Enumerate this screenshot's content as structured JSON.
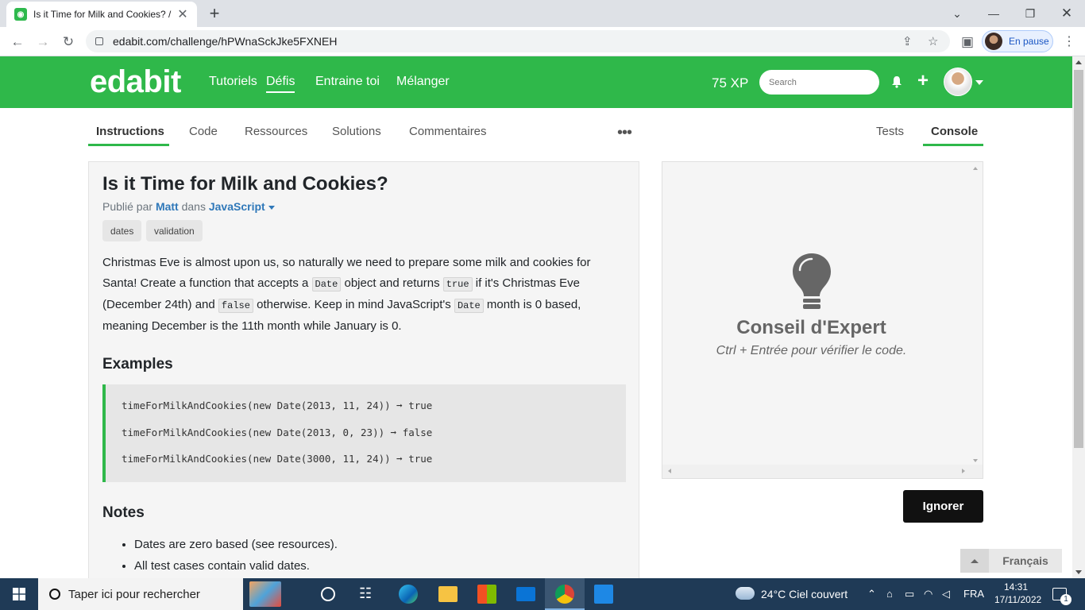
{
  "browser": {
    "tab_title": "Is it Time for Milk and Cookies? /",
    "url": "edabit.com/challenge/hPWnaSckJke5FXNEH",
    "profile_label": "En pause"
  },
  "site": {
    "logo": "edabit",
    "nav": [
      "Tutoriels",
      "Défis",
      "Entraine toi",
      "Mélanger"
    ],
    "active_nav": "Défis",
    "xp": "75 XP",
    "search_placeholder": "Search"
  },
  "tabs_left": [
    "Instructions",
    "Code",
    "Ressources",
    "Solutions",
    "Commentaires"
  ],
  "tabs_more": "•••",
  "tabs_right": [
    "Tests",
    "Console"
  ],
  "challenge": {
    "title": "Is it Time for Milk and Cookies?",
    "published_by": "Publié par",
    "author": "Matt",
    "in": "dans",
    "language": "JavaScript",
    "tags": [
      "dates",
      "validation"
    ],
    "desc_1": "Christmas Eve is almost upon us, so naturally we need to prepare some milk and cookies for Santa! Create a function that accepts a",
    "code_date": "Date",
    "desc_2": "object and returns",
    "code_true": "true",
    "desc_3": "if it's Christmas Eve (December 24th) and",
    "code_false": "false",
    "desc_4": "otherwise. Keep in mind JavaScript's",
    "desc_5": "month is 0 based, meaning December is the 11th month while January is 0.",
    "examples_heading": "Examples",
    "examples": [
      "timeForMilkAndCookies(new Date(2013, 11, 24)) ➞ true",
      "timeForMilkAndCookies(new Date(2013, 0, 23)) ➞ false",
      "timeForMilkAndCookies(new Date(3000, 11, 24)) ➞ true"
    ],
    "notes_heading": "Notes",
    "notes": [
      "Dates are zero based (see resources).",
      "All test cases contain valid dates."
    ]
  },
  "console": {
    "tip_title": "Conseil d'Expert",
    "tip_sub": "Ctrl + Entrée pour vérifier le code.",
    "ignore_button": "Ignorer",
    "language_selector": "Français"
  },
  "taskbar": {
    "search_placeholder": "Taper ici pour rechercher",
    "weather": "24°C  Ciel couvert",
    "lang": "FRA",
    "time": "14:31",
    "date": "17/11/2022",
    "notif_count": "1"
  },
  "colors": {
    "brand_green": "#2fb84a",
    "link_blue": "#2f78b9"
  }
}
